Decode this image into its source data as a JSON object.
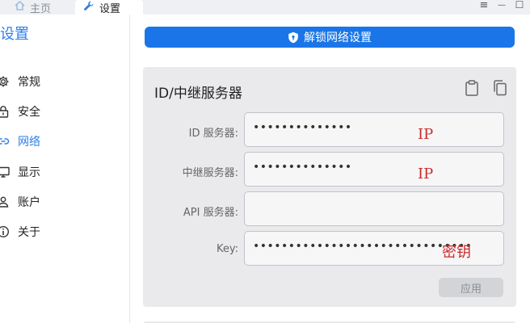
{
  "tabs": [
    {
      "label": "主页",
      "icon": "home-icon"
    },
    {
      "label": "设置",
      "icon": "wrench-icon"
    }
  ],
  "window_controls": {
    "menu": "≡",
    "minimize": "—",
    "maximize": "☐"
  },
  "sidebar": {
    "title": "设置",
    "items": [
      {
        "label": "常规",
        "icon": "gear-icon"
      },
      {
        "label": "安全",
        "icon": "lock-icon"
      },
      {
        "label": "网络",
        "icon": "link-icon",
        "active": true
      },
      {
        "label": "显示",
        "icon": "monitor-icon"
      },
      {
        "label": "账户",
        "icon": "user-icon"
      },
      {
        "label": "关于",
        "icon": "info-icon"
      }
    ]
  },
  "main": {
    "unlock_button": "解锁网络设置",
    "card": {
      "title": "ID/中继服务器",
      "fields": [
        {
          "label": "ID 服务器:",
          "value": "••••••••••••••",
          "annotation": "IP"
        },
        {
          "label": "中继服务器:",
          "value": "••••••••••••••",
          "annotation": "IP"
        },
        {
          "label": "API 服务器:",
          "value": "",
          "annotation": ""
        },
        {
          "label": "Key:",
          "value": "••••••••••••••••••••••••••••••••••••••••••••",
          "annotation": "密钥"
        }
      ],
      "apply_button": "应用"
    }
  },
  "colors": {
    "accent": "#1a76e8",
    "annotation": "#cc2b2b",
    "card_bg": "#eaeaec"
  }
}
